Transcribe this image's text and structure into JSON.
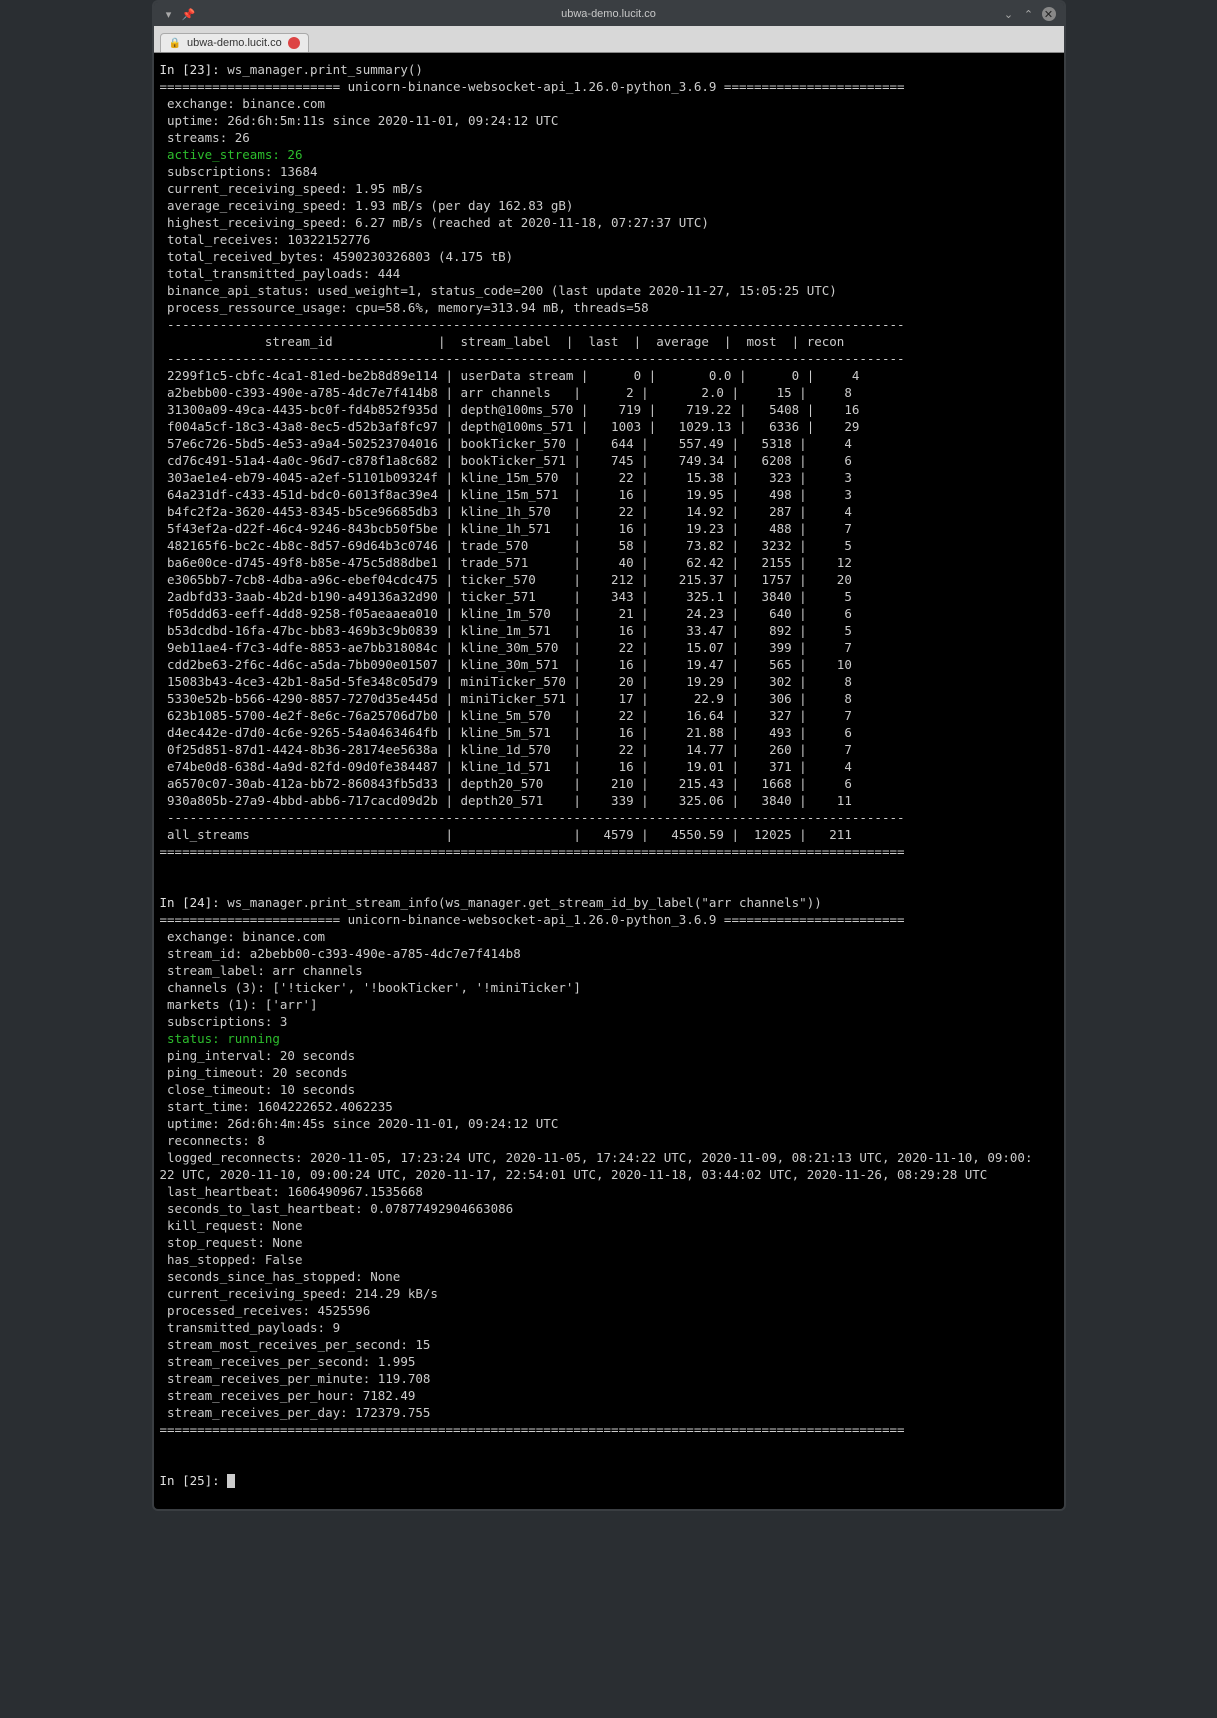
{
  "window": {
    "title": "ubwa-demo.lucit.co"
  },
  "tab": {
    "label": "ubwa-demo.lucit.co"
  },
  "input23": {
    "prompt": "In [23]: ",
    "code": "ws_manager.print_summary()"
  },
  "banner": "======================== unicorn-binance-websocket-api_1.26.0-python_3.6.9 ========================",
  "summary": {
    "exchange": " exchange: binance.com",
    "uptime": " uptime: 26d:6h:5m:11s since 2020-11-01, 09:24:12 UTC",
    "streams": " streams: 26",
    "active_streams": " active_streams: 26",
    "subscriptions": " subscriptions: 13684",
    "crs": " current_receiving_speed: 1.95 mB/s",
    "ars": " average_receiving_speed: 1.93 mB/s (per day 162.83 gB)",
    "hrs": " highest_receiving_speed: 6.27 mB/s (reached at 2020-11-18, 07:27:37 UTC)",
    "tr": " total_receives: 10322152776",
    "trb": " total_received_bytes: 4590230326803 (4.175 tB)",
    "ttp": " total_transmitted_payloads: 444",
    "api": " binance_api_status: used_weight=1, status_code=200 (last update 2020-11-27, 15:05:25 UTC)",
    "pru": " process_ressource_usage: cpu=58.6%, memory=313.94 mB, threads=58"
  },
  "table_sep": " --------------------------------------------------------------------------------------------------",
  "table_hdr": "              stream_id              |  stream_label  |  last  |  average  |  most  | recon",
  "rows": [
    " 2299f1c5-cbfc-4ca1-81ed-be2b8d89e114 | userData stream |      0 |       0.0 |      0 |     4",
    " a2bebb00-c393-490e-a785-4dc7e7f414b8 | arr channels   |      2 |       2.0 |     15 |     8",
    " 31300a09-49ca-4435-bc0f-fd4b852f935d | depth@100ms_570 |    719 |    719.22 |   5408 |    16",
    " f004a5cf-18c3-43a8-8ec5-d52b3af8fc97 | depth@100ms_571 |   1003 |   1029.13 |   6336 |    29",
    " 57e6c726-5bd5-4e53-a9a4-502523704016 | bookTicker_570 |    644 |    557.49 |   5318 |     4",
    " cd76c491-51a4-4a0c-96d7-c878f1a8c682 | bookTicker_571 |    745 |    749.34 |   6208 |     6",
    " 303ae1e4-eb79-4045-a2ef-51101b09324f | kline_15m_570  |     22 |     15.38 |    323 |     3",
    " 64a231df-c433-451d-bdc0-6013f8ac39e4 | kline_15m_571  |     16 |     19.95 |    498 |     3",
    " b4fc2f2a-3620-4453-8345-b5ce96685db3 | kline_1h_570   |     22 |     14.92 |    287 |     4",
    " 5f43ef2a-d22f-46c4-9246-843bcb50f5be | kline_1h_571   |     16 |     19.23 |    488 |     7",
    " 482165f6-bc2c-4b8c-8d57-69d64b3c0746 | trade_570      |     58 |     73.82 |   3232 |     5",
    " ba6e00ce-d745-49f8-b85e-475c5d88dbe1 | trade_571      |     40 |     62.42 |   2155 |    12",
    " e3065bb7-7cb8-4dba-a96c-ebef04cdc475 | ticker_570     |    212 |    215.37 |   1757 |    20",
    " 2adbfd33-3aab-4b2d-b190-a49136a32d90 | ticker_571     |    343 |     325.1 |   3840 |     5",
    " f05ddd63-eeff-4dd8-9258-f05aeaaea010 | kline_1m_570   |     21 |     24.23 |    640 |     6",
    " b53dcdbd-16fa-47bc-bb83-469b3c9b0839 | kline_1m_571   |     16 |     33.47 |    892 |     5",
    " 9eb11ae4-f7c3-4dfe-8853-ae7bb318084c | kline_30m_570  |     22 |     15.07 |    399 |     7",
    " cdd2be63-2f6c-4d6c-a5da-7bb090e01507 | kline_30m_571  |     16 |     19.47 |    565 |    10",
    " 15083b43-4ce3-42b1-8a5d-5fe348c05d79 | miniTicker_570 |     20 |     19.29 |    302 |     8",
    " 5330e52b-b566-4290-8857-7270d35e445d | miniTicker_571 |     17 |      22.9 |    306 |     8",
    " 623b1085-5700-4e2f-8e6c-76a25706d7b0 | kline_5m_570   |     22 |     16.64 |    327 |     7",
    " d4ec442e-d7d0-4c6e-9265-54a0463464fb | kline_5m_571   |     16 |     21.88 |    493 |     6",
    " 0f25d851-87d1-4424-8b36-28174ee5638a | kline_1d_570   |     22 |     14.77 |    260 |     7",
    " e74be0d8-638d-4a9d-82fd-09d0fe384487 | kline_1d_571   |     16 |     19.01 |    371 |     4",
    " a6570c07-30ab-412a-bb72-860843fb5d33 | depth20_570    |    210 |    215.43 |   1668 |     6",
    " 930a805b-27a9-4bbd-abb6-717cacd09d2b | depth20_571    |    339 |    325.06 |   3840 |    11"
  ],
  "all_streams": " all_streams                          |                |   4579 |   4550.59 |  12025 |   211",
  "footer_eq": "===================================================================================================",
  "input24": {
    "prompt": "In [24]: ",
    "code": "ws_manager.print_stream_info(ws_manager.get_stream_id_by_label(\"arr channels\"))"
  },
  "info": {
    "exchange": " exchange: binance.com",
    "stream_id": " stream_id: a2bebb00-c393-490e-a785-4dc7e7f414b8",
    "stream_label": " stream_label: arr channels",
    "channels": " channels (3): ['!ticker', '!bookTicker', '!miniTicker']",
    "markets": " markets (1): ['arr']",
    "subscriptions": " subscriptions: 3",
    "status": " status: running",
    "ping_interval": " ping_interval: 20 seconds",
    "ping_timeout": " ping_timeout: 20 seconds",
    "close_timeout": " close_timeout: 10 seconds",
    "start_time": " start_time: 1604222652.4062235",
    "uptime": " uptime: 26d:6h:4m:45s since 2020-11-01, 09:24:12 UTC",
    "reconnects": " reconnects: 8",
    "logged1": " logged_reconnects: 2020-11-05, 17:23:24 UTC, 2020-11-05, 17:24:22 UTC, 2020-11-09, 08:21:13 UTC, 2020-11-10, 09:00:",
    "logged2": "22 UTC, 2020-11-10, 09:00:24 UTC, 2020-11-17, 22:54:01 UTC, 2020-11-18, 03:44:02 UTC, 2020-11-26, 08:29:28 UTC",
    "last_hb": " last_heartbeat: 1606490967.1535668",
    "sec_hb": " seconds_to_last_heartbeat: 0.07877492904663086",
    "kill": " kill_request: None",
    "stop": " stop_request: None",
    "hs": " has_stopped: False",
    "sshs": " seconds_since_has_stopped: None",
    "crs": " current_receiving_speed: 214.29 kB/s",
    "pr": " processed_receives: 4525596",
    "tp": " transmitted_payloads: 9",
    "smrps": " stream_most_receives_per_second: 15",
    "srps": " stream_receives_per_second: 1.995",
    "srpm": " stream_receives_per_minute: 119.708",
    "srph": " stream_receives_per_hour: 7182.49",
    "srpd": " stream_receives_per_day: 172379.755"
  },
  "input25": {
    "prompt": "In [25]: "
  }
}
